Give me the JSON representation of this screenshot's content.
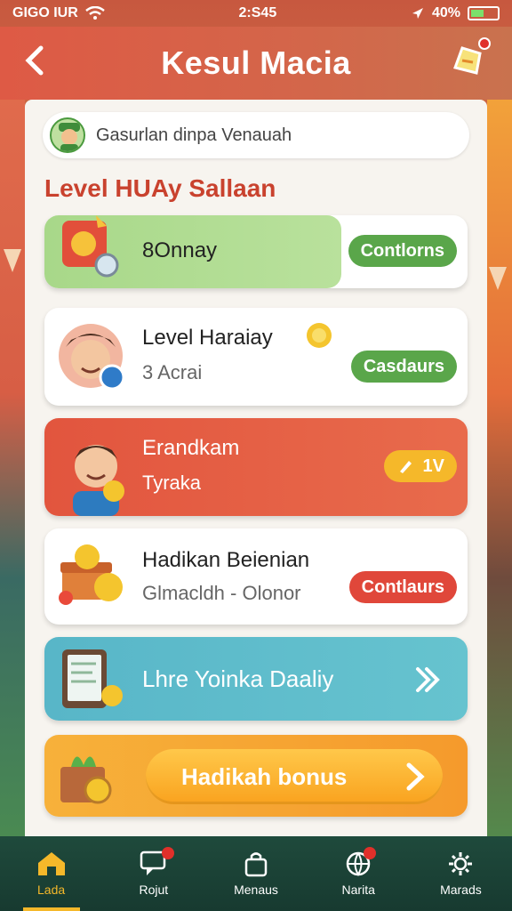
{
  "status_bar": {
    "carrier": "GIGO IUR",
    "time": "2:S45",
    "battery": "40%"
  },
  "header": {
    "title": "Kesul Macia"
  },
  "greeting": {
    "text": "Gasurlan dinpa Venauah"
  },
  "section": {
    "title": "Level HUAy Sallaan"
  },
  "cards": [
    {
      "label": "8Onnay",
      "button": "Contlorns"
    },
    {
      "label": "Level Haraiay",
      "sub": "3 Acrai",
      "button": "Casdaurs"
    },
    {
      "label": "Erandkam",
      "sub": "Tyraka",
      "button": "1V"
    },
    {
      "label": "Hadikan Beienian",
      "sub": "Glmacldh - Olonor",
      "button": "Contlaurs"
    },
    {
      "label": "Lhre Yoinka Daaliy"
    },
    {
      "button": "Hadikah bonus"
    }
  ],
  "nav": [
    {
      "label": "Lada",
      "icon": "home-icon",
      "active": true
    },
    {
      "label": "Rojut",
      "icon": "chat-icon"
    },
    {
      "label": "Menaus",
      "icon": "bag-icon"
    },
    {
      "label": "Narita",
      "icon": "globe-icon"
    },
    {
      "label": "Marads",
      "icon": "gear-icon"
    }
  ],
  "colors": {
    "accent": "#e0473a",
    "green": "#5aa64a",
    "nav_bg": "#1f4a3c",
    "highlight": "#f5b82a"
  }
}
